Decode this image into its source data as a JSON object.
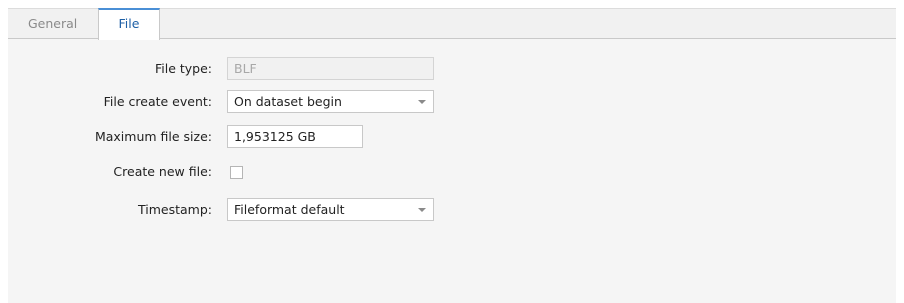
{
  "tabs": [
    {
      "label": "General",
      "active": false
    },
    {
      "label": "File",
      "active": true
    }
  ],
  "form": {
    "file_type": {
      "label": "File type:",
      "value": "BLF",
      "disabled": true
    },
    "file_create_event": {
      "label": "File create event:",
      "value": "On dataset begin"
    },
    "max_file_size": {
      "label": "Maximum file size:",
      "value": "1,953125 GB"
    },
    "create_new_file": {
      "label": "Create new file:",
      "checked": false
    },
    "timestamp": {
      "label": "Timestamp:",
      "value": "Fileformat default"
    }
  },
  "icons": {
    "dropdown_arrow": "chevron-down-icon"
  },
  "colors": {
    "active_tab_text": "#1d5fa6",
    "active_tab_accent": "#4a8fd6",
    "panel_background": "#f5f5f5"
  }
}
